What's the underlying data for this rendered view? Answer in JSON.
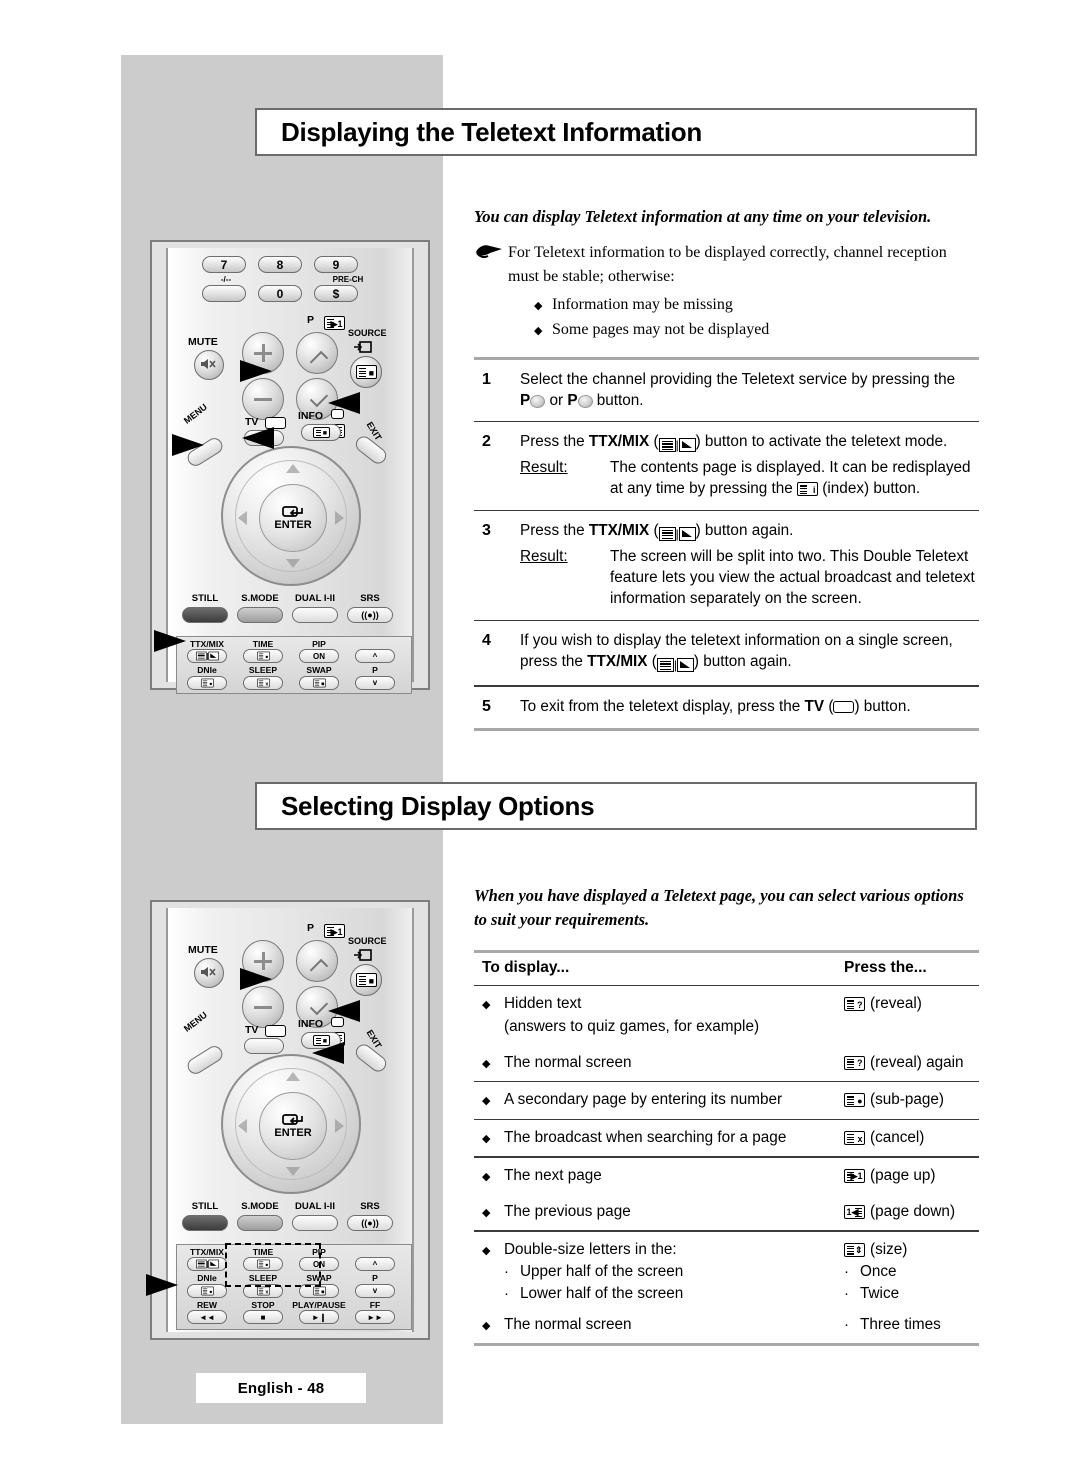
{
  "page": {
    "footer_label": "English - 48",
    "background_color": "#ffffff",
    "panel_color": "#cccccc"
  },
  "sections": [
    {
      "id": "displaying-teletext",
      "heading": "Displaying the Teletext Information",
      "intro": "You can display Teletext information at any time on your television.",
      "note": {
        "icon": "pointing-hand-icon",
        "text": "For Teletext information to be displayed correctly, channel reception must be stable; otherwise:",
        "bullets": [
          "Information may be missing",
          "Some pages may not be displayed"
        ]
      },
      "steps": [
        {
          "num": "1",
          "text_parts": [
            {
              "t": "Select the channel providing the Teletext service by pressing the "
            },
            {
              "b": "P"
            },
            {
              "icon": "p-up-round-icon"
            },
            {
              "t": " or "
            },
            {
              "b": "P"
            },
            {
              "icon": "p-down-round-icon"
            },
            {
              "t": " button."
            }
          ],
          "result": null
        },
        {
          "num": "2",
          "text_parts": [
            {
              "t": "Press the "
            },
            {
              "b": "TTX/MIX"
            },
            {
              "t": " ("
            },
            {
              "icon": "ttx-mix-icon"
            },
            {
              "t": ") button to activate the teletext mode."
            }
          ],
          "result": {
            "label": "Result:",
            "parts": [
              {
                "t": "The contents page is displayed. It can be redisplayed at any time by pressing the "
              },
              {
                "icon": "index-icon"
              },
              {
                "t": " (index) button."
              }
            ]
          }
        },
        {
          "num": "3",
          "text_parts": [
            {
              "t": "Press the "
            },
            {
              "b": "TTX/MIX"
            },
            {
              "t": " ("
            },
            {
              "icon": "ttx-mix-icon"
            },
            {
              "t": ") button again."
            }
          ],
          "result": {
            "label": "Result:",
            "parts": [
              {
                "t": "The screen will be split into two. This Double Teletext feature lets you view the actual broadcast and teletext information separately on the screen."
              }
            ]
          }
        },
        {
          "num": "4",
          "text_parts": [
            {
              "t": "If you wish to display the teletext information on a single screen, press the "
            },
            {
              "b": "TTX/MIX"
            },
            {
              "t": " ("
            },
            {
              "icon": "ttx-mix-icon"
            },
            {
              "t": ") button again."
            }
          ],
          "result": null
        },
        {
          "num": "5",
          "text_parts": [
            {
              "t": "To exit from the teletext display, press the "
            },
            {
              "b": "TV"
            },
            {
              "t": " ("
            },
            {
              "icon": "tv-icon"
            },
            {
              "t": ") button."
            }
          ],
          "result": null
        }
      ]
    },
    {
      "id": "selecting-display-options",
      "heading": "Selecting Display Options",
      "intro": "When you have displayed a Teletext page, you can select various options to suit your requirements.",
      "table": {
        "headers": [
          "To display...",
          "Press the..."
        ],
        "groups": [
          {
            "rows": [
              {
                "left": "Hidden text",
                "left_sub_plain": "(answers to quiz games, for example)",
                "right_icon": "reveal-icon",
                "right": "(reveal)"
              },
              {
                "left": "The normal screen",
                "right_icon": "reveal-icon",
                "right": "(reveal) again"
              }
            ]
          },
          {
            "rows": [
              {
                "left": "A secondary page by entering its number",
                "right_icon": "sub-page-icon",
                "right": "(sub-page)"
              }
            ]
          },
          {
            "rows": [
              {
                "left": "The broadcast when searching for a page",
                "right_icon": "cancel-icon",
                "right": "(cancel)"
              }
            ]
          },
          {
            "rows": [
              {
                "left": "The next page",
                "right_icon": "page-up-icon",
                "right": "(page up)"
              },
              {
                "left": "The previous page",
                "right_icon": "page-down-icon",
                "right": "(page down)"
              }
            ]
          },
          {
            "rows": [
              {
                "left": "Double-size letters in the:",
                "left_subs": [
                  "Upper half of the screen",
                  "Lower half of the screen"
                ],
                "right_icon": "size-icon",
                "right": "(size)",
                "right_subs": [
                  "Once",
                  "Twice"
                ]
              },
              {
                "left": "The normal screen",
                "right_subs": [
                  "Three times"
                ]
              }
            ]
          }
        ]
      }
    }
  ],
  "remotes": {
    "top": {
      "number_keys": [
        "7",
        "8",
        "9"
      ],
      "number_keys_row2": [
        "",
        "0",
        ""
      ],
      "caps": {
        "minus": "-/--",
        "prech": "PRE-CH",
        "prech_glyph": "$"
      },
      "labels": {
        "mute": "MUTE",
        "p": "P",
        "source": "SOURCE",
        "tv": "TV",
        "info": "INFO",
        "menu": "MENU",
        "exit": "EXIT",
        "enter": "ENTER"
      },
      "function_row": [
        {
          "cap": "STILL",
          "style": "dark"
        },
        {
          "cap": "S.MODE",
          "style": "mid"
        },
        {
          "cap": "DUAL I-II",
          "style": "light"
        },
        {
          "cap": "SRS",
          "style": "srs",
          "glyph": "((●))"
        }
      ],
      "pad": [
        {
          "cap": "TTX/MIX"
        },
        {
          "cap": "TIME"
        },
        {
          "cap": "PIP"
        },
        {
          "cap": ""
        },
        {
          "cap": "DNIe"
        },
        {
          "cap": "SLEEP"
        },
        {
          "cap": "SWAP",
          "glyph": ""
        },
        {
          "cap": "P"
        }
      ],
      "pad_inline": [
        "ON"
      ]
    },
    "bottom": {
      "labels": {
        "mute": "MUTE",
        "p": "P",
        "source": "SOURCE",
        "tv": "TV",
        "info": "INFO",
        "menu": "MENU",
        "exit": "EXIT",
        "enter": "ENTER"
      },
      "function_row": [
        {
          "cap": "STILL",
          "style": "dark"
        },
        {
          "cap": "S.MODE",
          "style": "mid"
        },
        {
          "cap": "DUAL I-II",
          "style": "light"
        },
        {
          "cap": "SRS",
          "style": "srs",
          "glyph": "((●))"
        }
      ],
      "pad": [
        {
          "cap": "TTX/MIX"
        },
        {
          "cap": "TIME"
        },
        {
          "cap": "PIP"
        },
        {
          "cap": ""
        },
        {
          "cap": "DNIe"
        },
        {
          "cap": "SLEEP"
        },
        {
          "cap": "SWAP"
        },
        {
          "cap": "P"
        },
        {
          "cap": "REW",
          "glyph": "◄◄"
        },
        {
          "cap": "STOP",
          "glyph": "■"
        },
        {
          "cap": "PLAY/PAUSE",
          "glyph": "►❙"
        },
        {
          "cap": "FF",
          "glyph": "►►"
        }
      ],
      "pad_inline": [
        "ON"
      ]
    }
  }
}
